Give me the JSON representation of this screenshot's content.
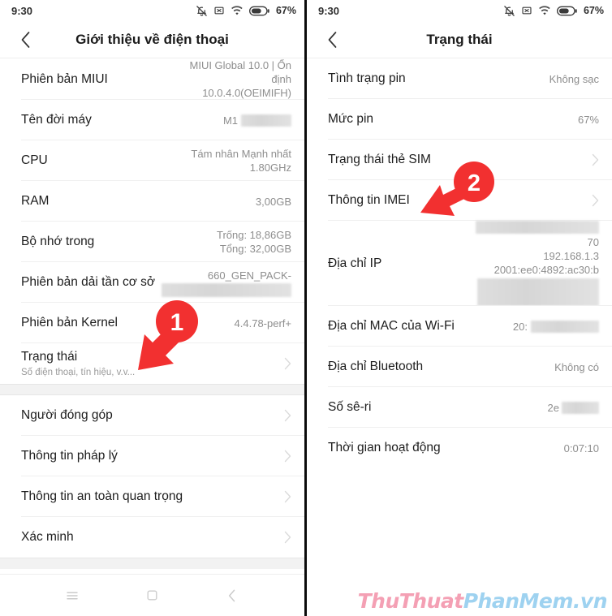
{
  "status_bar": {
    "time": "9:30",
    "battery_percent": "67%",
    "icons": [
      "bell-muted-icon",
      "no-sim-icon",
      "wifi-icon",
      "battery-icon"
    ]
  },
  "left_phone": {
    "appbar": {
      "back_icon": "chevron-left-icon",
      "title": "Giới thiệu về điện thoại"
    },
    "rows": [
      {
        "title": "Phiên bản MIUI",
        "value": "MIUI Global 10.0 | Ổn\nđịnh\n10.0.4.0(OEIMIFH)",
        "chevron": false,
        "redacted": false
      },
      {
        "title": "Tên đời máy",
        "value": "M1",
        "chevron": false,
        "redacted": true
      },
      {
        "title": "CPU",
        "value": "Tám nhân Mạnh nhất\n1.80GHz",
        "chevron": false,
        "redacted": false
      },
      {
        "title": "RAM",
        "value": "3,00GB",
        "chevron": false,
        "redacted": false
      },
      {
        "title": "Bộ nhớ trong",
        "value": "Trống: 18,86GB\nTổng: 32,00GB",
        "chevron": false,
        "redacted": false
      },
      {
        "title": "Phiên bản dải tần cơ sở",
        "value": "660_GEN_PACK-",
        "chevron": false,
        "redacted": true
      },
      {
        "title": "Phiên bản Kernel",
        "value": "4.4.78-perf+",
        "chevron": false,
        "redacted": false
      },
      {
        "title": "Trạng thái",
        "subtitle": "Số điện thoại, tín hiệu, v.v...",
        "value": "",
        "chevron": true,
        "redacted": false
      }
    ],
    "rows_group2": [
      {
        "title": "Người đóng góp",
        "value": "",
        "chevron": true
      },
      {
        "title": "Thông tin pháp lý",
        "value": "",
        "chevron": true
      },
      {
        "title": "Thông tin an toàn quan trọng",
        "value": "",
        "chevron": true
      },
      {
        "title": "Xác minh",
        "value": "",
        "chevron": true
      }
    ],
    "annotation": {
      "number": "1"
    },
    "navbar": [
      "menu-icon",
      "home-icon",
      "back-icon"
    ]
  },
  "right_phone": {
    "appbar": {
      "back_icon": "chevron-left-icon",
      "title": "Trạng thái"
    },
    "rows": [
      {
        "title": "Tình trạng pin",
        "value": "Không sạc",
        "chevron": false,
        "redacted": false
      },
      {
        "title": "Mức pin",
        "value": "67%",
        "chevron": false,
        "redacted": false
      },
      {
        "title": "Trạng thái thẻ SIM",
        "value": "",
        "chevron": true,
        "redacted": false
      },
      {
        "title": "Thông tin IMEI",
        "value": "",
        "chevron": true,
        "redacted": false
      },
      {
        "title": "Địa chỉ IP",
        "value": "70\n192.168.1.3\n2001:ee0:4892:ac30:b",
        "chevron": false,
        "redacted": true
      },
      {
        "title": "Địa chỉ MAC của Wi-Fi",
        "value": "20:",
        "chevron": false,
        "redacted": true
      },
      {
        "title": "Địa chỉ Bluetooth",
        "value": "Không có",
        "chevron": false,
        "redacted": false
      },
      {
        "title": "Số sê-ri",
        "value": "2e",
        "chevron": false,
        "redacted": true
      },
      {
        "title": "Thời gian hoạt động",
        "value": "0:07:10",
        "chevron": false,
        "redacted": false
      }
    ],
    "annotation": {
      "number": "2"
    }
  },
  "watermark": {
    "part1": "ThuThuat",
    "part2": "PhanMem.vn"
  },
  "colors": {
    "accent_red": "#f23030",
    "text_primary": "#1d1d1d",
    "text_secondary": "#8e8e8e",
    "divider": "#efefef",
    "gap_bg": "#f2f2f2"
  }
}
